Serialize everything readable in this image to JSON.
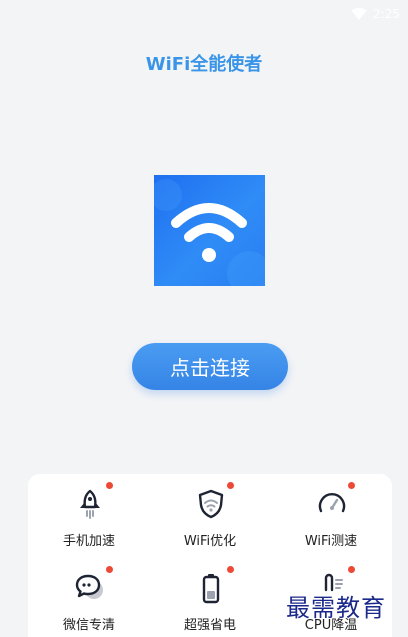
{
  "status_bar": {
    "time": "2:25"
  },
  "app": {
    "title": "WiFi全能使者"
  },
  "main": {
    "connect_label": "点击连接"
  },
  "tools": [
    {
      "label": "手机加速",
      "icon": "rocket-icon"
    },
    {
      "label": "WiFi优化",
      "icon": "shield-wifi-icon"
    },
    {
      "label": "WiFi测速",
      "icon": "speedometer-icon"
    },
    {
      "label": "微信专清",
      "icon": "chat-bubble-icon"
    },
    {
      "label": "超强省电",
      "icon": "battery-icon"
    },
    {
      "label": "CPU降温",
      "icon": "thermometer-icon"
    }
  ],
  "watermark": {
    "text": "最需教育"
  },
  "colors": {
    "accent": "#3a95e8",
    "button": "#3584e6",
    "badge": "#ec4a36",
    "logo_bg": "#1f6ff0"
  }
}
